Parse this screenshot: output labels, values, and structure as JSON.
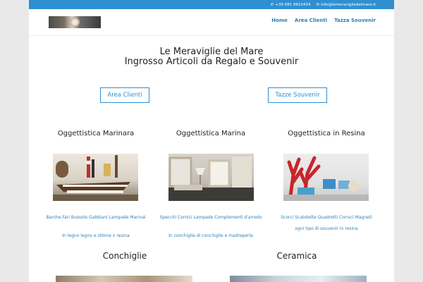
{
  "topbar": {
    "phone": "+39 081 8810434",
    "email": "info@lemeravigliedelmare.it"
  },
  "nav": {
    "items": [
      "Home",
      "Area Clienti",
      "Tazza Souvenir"
    ]
  },
  "hero": {
    "line1": "Le Meraviglie del Mare",
    "line2": "Ingrosso Articoli da Regalo e Souvenir"
  },
  "buttons": {
    "area_clienti": "Area Clienti",
    "tazze_souvenir": "Tazze Souvenir"
  },
  "columns": [
    {
      "title": "Oggettistica Marinara",
      "caption1": "Barche  Fari Bussole Gabbiani Lampade Marinai",
      "caption2": "In legno  legno e ottone o resina"
    },
    {
      "title": "Oggettistica Marina",
      "caption1": "Specchi Cornici Lampade Complementi d'arredo",
      "caption2": "In conchiglie di conchiglie e madreperla"
    },
    {
      "title": "Oggettistica in Resina",
      "caption1": "Scorci  Scatolette Quadretti Cornici Magneti",
      "caption2": "ogni tipo di souvenir in resina"
    }
  ],
  "sections": {
    "left": "Conchiglie",
    "right": "Ceramica"
  },
  "colors": {
    "accent": "#2f8fd0",
    "link": "#2f7fb5"
  },
  "icons": {
    "phone": "phone-icon",
    "email": "mail-icon"
  }
}
